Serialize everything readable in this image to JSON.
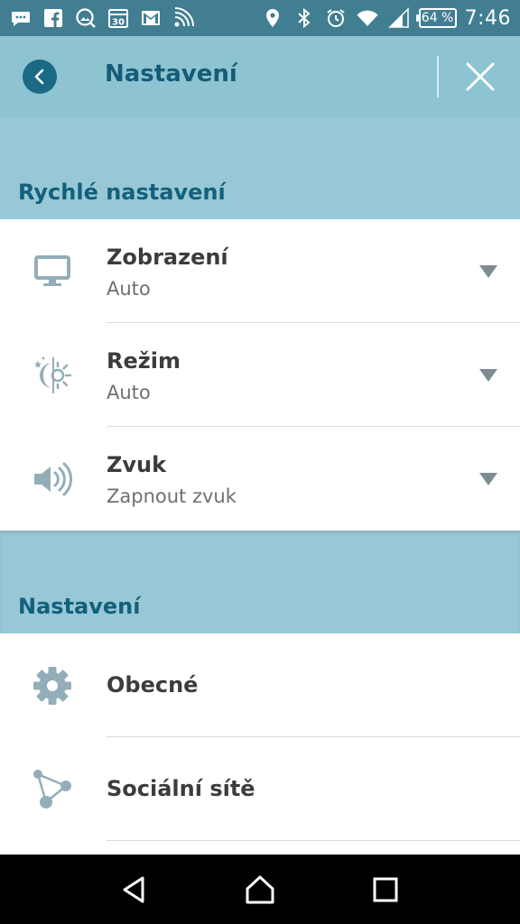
{
  "status_bar": {
    "battery": "64 %",
    "time": "7:46",
    "icons_left": [
      "messaging-icon",
      "facebook-icon",
      "gallery-icon",
      "calendar-icon",
      "gmail-icon",
      "wireless-icon"
    ],
    "icons_right": [
      "location-icon",
      "bluetooth-icon",
      "alarm-icon",
      "wifi-icon",
      "signal-icon"
    ]
  },
  "app_bar": {
    "title": "Nastavení"
  },
  "quick_settings": {
    "header": "Rychlé nastavení",
    "items": [
      {
        "title": "Zobrazení",
        "subtitle": "Auto",
        "icon": "monitor-icon"
      },
      {
        "title": "Režim",
        "subtitle": "Auto",
        "icon": "day-night-icon"
      },
      {
        "title": "Zvuk",
        "subtitle": "Zapnout zvuk",
        "icon": "speaker-icon"
      }
    ]
  },
  "settings": {
    "header": "Nastavení",
    "items": [
      {
        "title": "Obecné",
        "icon": "gear-icon"
      },
      {
        "title": "Sociální sítě",
        "icon": "share-nodes-icon"
      }
    ]
  },
  "colors": {
    "status_bar": "#427e91",
    "app_bar": "#8ec3d1",
    "section_header": "#98c8d5",
    "accent_dark": "#155c78",
    "icon_gray": "#93aeb8"
  }
}
